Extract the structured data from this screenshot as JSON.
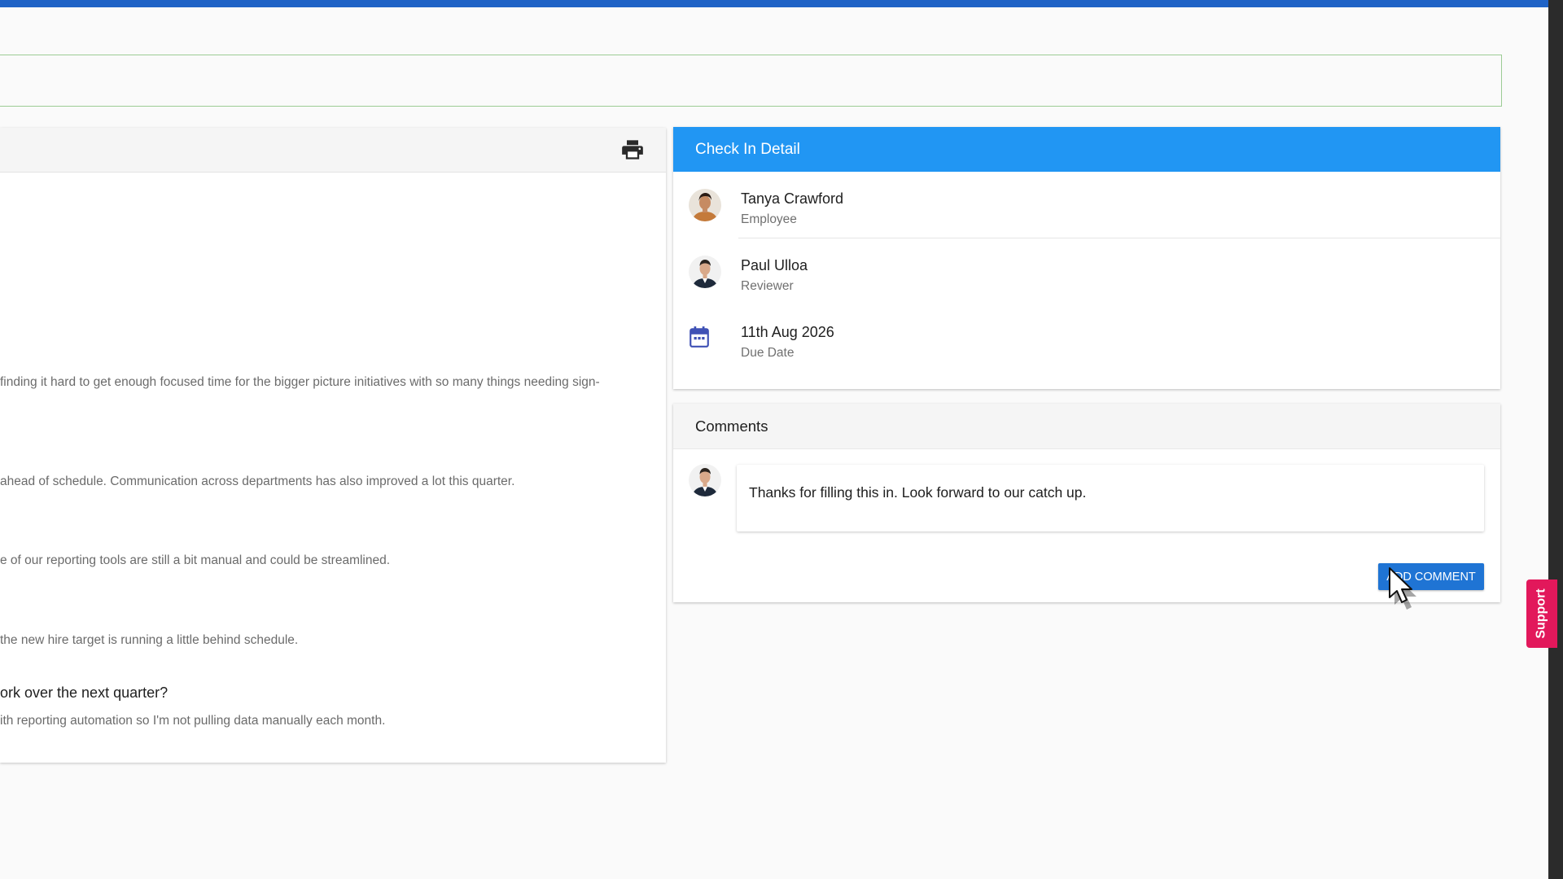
{
  "left_panel": {
    "answers": [
      "finding it hard to get enough focused time for the bigger picture initiatives with so many things needing sign-",
      "ahead of schedule. Communication across departments has also improved a lot this quarter.",
      "e of our reporting tools are still a bit manual and could be streamlined.",
      "the new hire target is running a little behind schedule."
    ],
    "question": "ork over the next quarter?",
    "last_answer": "ith reporting automation so I'm not pulling data manually each month."
  },
  "check_in_detail": {
    "title": "Check In Detail",
    "employee": {
      "name": "Tanya Crawford",
      "role": "Employee"
    },
    "reviewer": {
      "name": "Paul Ulloa",
      "role": "Reviewer"
    },
    "due": {
      "date": "11th Aug 2026",
      "label": "Due Date"
    }
  },
  "comments": {
    "title": "Comments",
    "items": [
      {
        "text": "Thanks for filling this in. Look forward to our catch up."
      }
    ],
    "add_button_label": "ADD COMMENT"
  },
  "support_tab": {
    "label": "Support"
  },
  "icons": {
    "print": "print-icon",
    "calendar": "calendar-icon",
    "cursor": "mouse-pointer-icon"
  },
  "colors": {
    "top_bar": "#1f63c6",
    "detail_header": "#2196f3",
    "add_button": "#1f74d4",
    "support_tab": "#e2185b",
    "banner_border": "#9ccc94"
  }
}
